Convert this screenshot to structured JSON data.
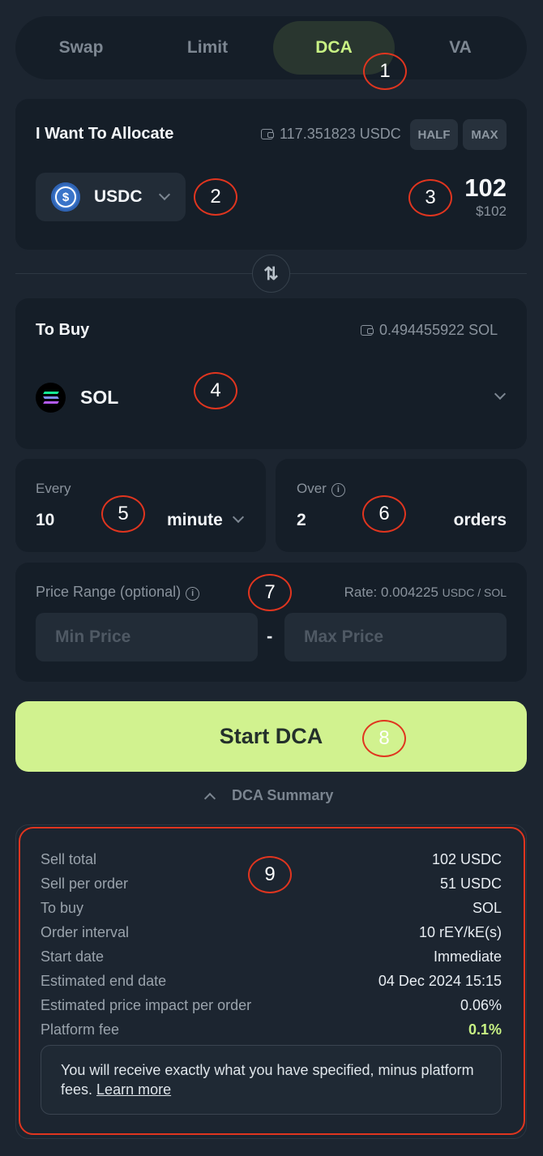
{
  "tabs": [
    {
      "label": "Swap"
    },
    {
      "label": "Limit"
    },
    {
      "label": "DCA"
    },
    {
      "label": "VA"
    }
  ],
  "allocate": {
    "title": "I Want To Allocate",
    "balance": "117.351823 USDC",
    "half_label": "HALF",
    "max_label": "MAX",
    "token": "USDC",
    "token_icon": "usdc-logo",
    "amount": "102",
    "amount_usd": "$102"
  },
  "buy": {
    "title": "To Buy",
    "balance": "0.494455922 SOL",
    "token": "SOL",
    "token_icon": "solana-logo"
  },
  "every": {
    "label": "Every",
    "value": "10",
    "unit": "minute"
  },
  "over": {
    "label": "Over",
    "value": "2",
    "unit": "orders"
  },
  "price_range": {
    "label": "Price Range (optional)",
    "rate_label": "Rate: 0.004225",
    "rate_unit": "USDC / SOL",
    "min_placeholder": "Min Price",
    "max_placeholder": "Max Price",
    "separator": "-"
  },
  "start_button": "Start DCA",
  "summary_toggle": "DCA Summary",
  "summary": {
    "rows": [
      {
        "label": "Sell total",
        "value": "102 USDC"
      },
      {
        "label": "Sell per order",
        "value": "51 USDC"
      },
      {
        "label": "To buy",
        "value": "SOL"
      },
      {
        "label": "Order interval",
        "value": "10 rEY/kE(s)"
      },
      {
        "label": "Start date",
        "value": "Immediate"
      },
      {
        "label": "Estimated end date",
        "value": "04 Dec 2024 15:15"
      },
      {
        "label": "Estimated price impact per order",
        "value": "0.06%"
      },
      {
        "label": "Platform fee",
        "value": "0.1%"
      }
    ],
    "note_text": "You will receive exactly what you have specified, minus platform fees.",
    "note_link": "Learn more"
  },
  "callouts": [
    "1",
    "2",
    "3",
    "4",
    "5",
    "6",
    "7",
    "8",
    "9"
  ],
  "colors": {
    "accent": "#c8f284",
    "button": "#d1f28f",
    "callout": "#e0351f",
    "fee": "#c8f284"
  }
}
